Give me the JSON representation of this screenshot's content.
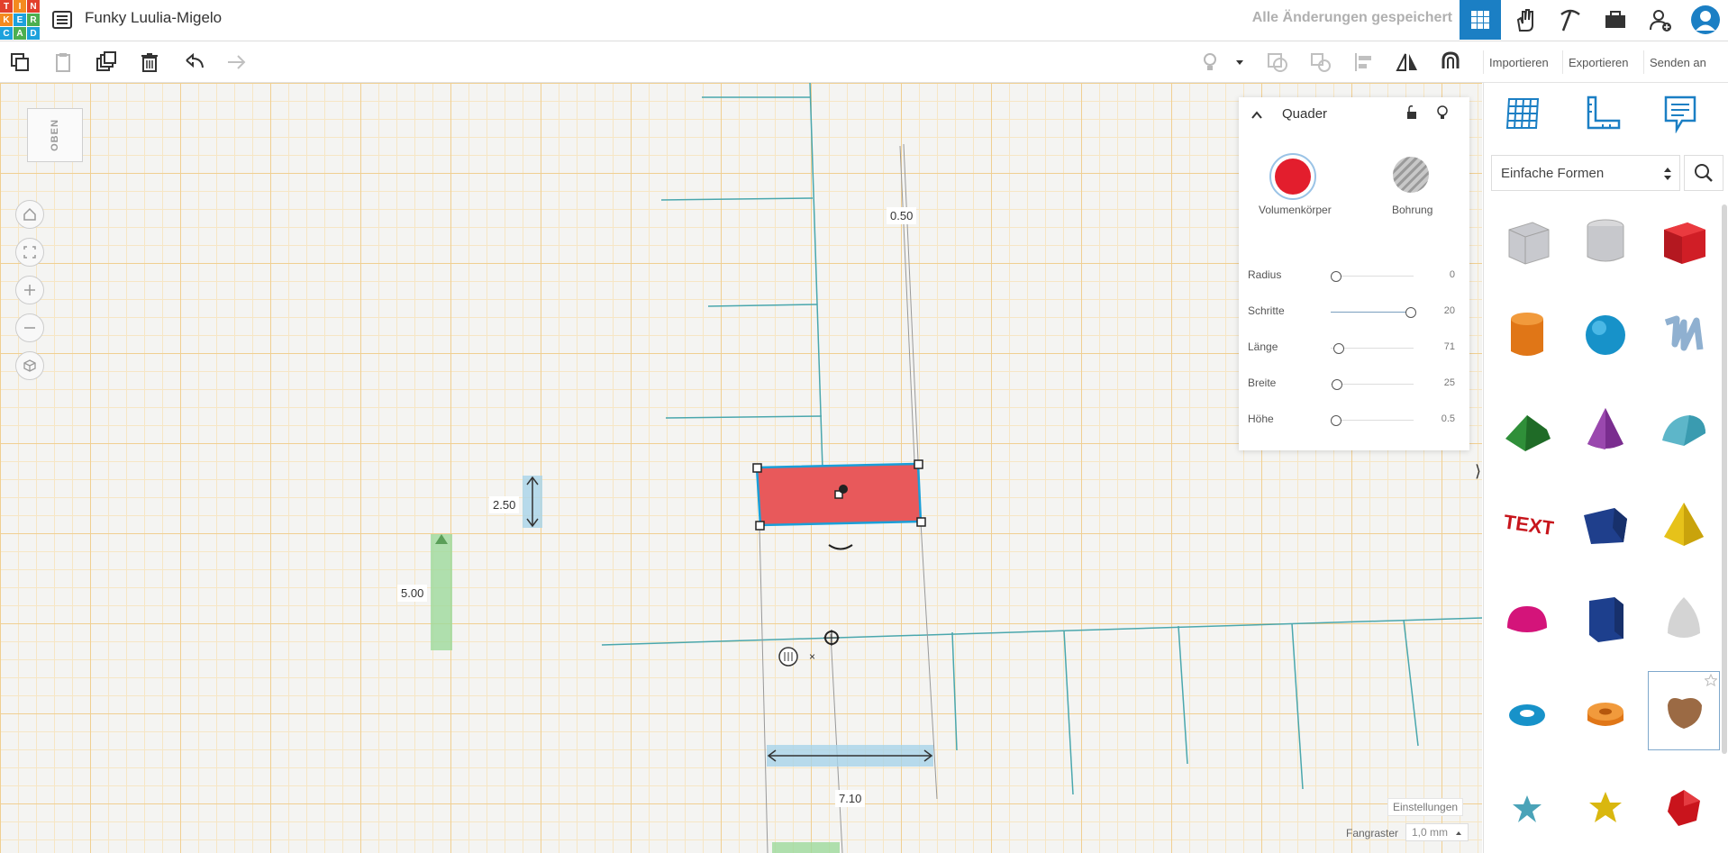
{
  "app": {
    "logo_letters": [
      "T",
      "I",
      "N",
      "K",
      "E",
      "R",
      "C",
      "A",
      "D"
    ],
    "logo_colors": [
      "#e2402c",
      "#f48a1f",
      "#e2402c",
      "#f48a1f",
      "#1da1dc",
      "#4caf50",
      "#1da1dc",
      "#4caf50",
      "#1da1dc"
    ],
    "document_title": "Funky Luulia-Migelo",
    "save_status": "Alle Änderungen gespeichert"
  },
  "header_buttons": {
    "import": "Importieren",
    "export": "Exportieren",
    "send": "Senden an"
  },
  "workplane": {
    "view_cube_label": "OBEN",
    "dimensions": {
      "height_top": "0.50",
      "width_side": "2.50",
      "length_bottom": "7.10",
      "green_marker": "5.00"
    },
    "settings_label": "Einstellungen",
    "snap_label": "Fangraster",
    "snap_value": "1,0 mm"
  },
  "inspector": {
    "title": "Quader",
    "solid_label": "Volumenkörper",
    "hole_label": "Bohrung",
    "properties": [
      {
        "label": "Radius",
        "value": "0",
        "fraction": 0.0
      },
      {
        "label": "Schritte",
        "value": "20",
        "fraction": 0.98
      },
      {
        "label": "Länge",
        "value": "71",
        "fraction": 0.02
      },
      {
        "label": "Breite",
        "value": "25",
        "fraction": 0.0
      },
      {
        "label": "Höhe",
        "value": "0.5",
        "fraction": 0.0
      }
    ]
  },
  "shape_panel": {
    "category": "Einfache Formen"
  },
  "colors": {
    "accent": "#1b7fc4",
    "selected_shape": "#e8595b",
    "solid": "#e31e2d"
  }
}
